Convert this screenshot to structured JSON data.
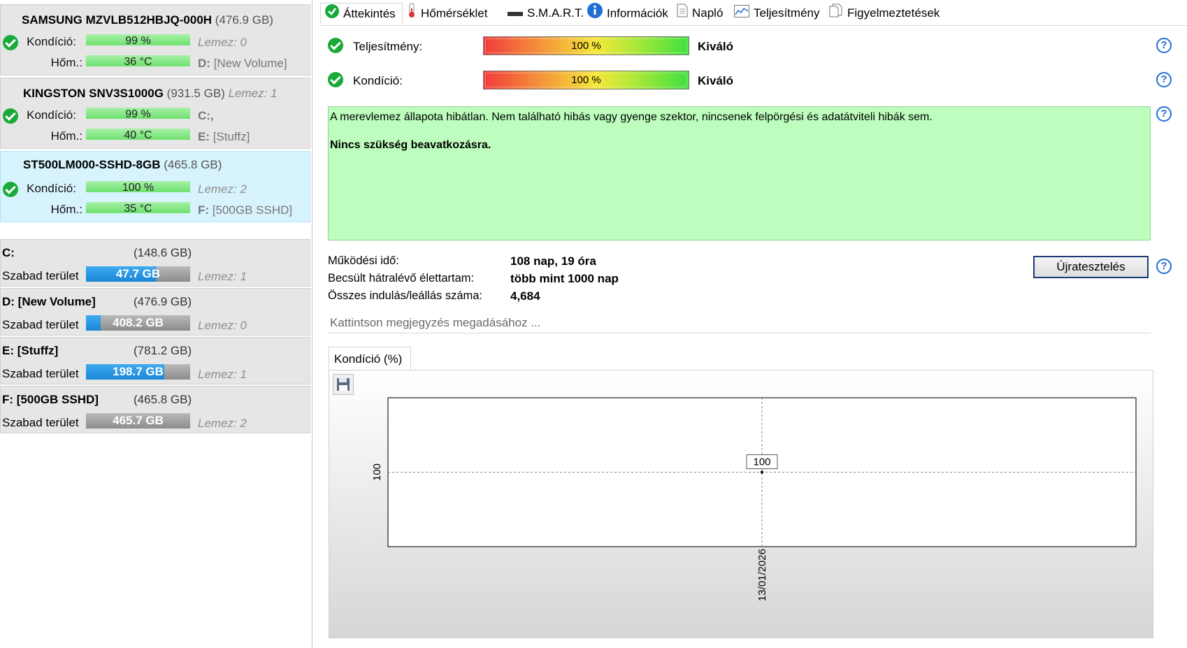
{
  "disks": [
    {
      "model": "SAMSUNG MZVLB512HBJQ-000H",
      "size": "(476.9 GB)",
      "condition_label": "Kondíció:",
      "condition": "99 %",
      "temp_label": "Hőm.:",
      "temp": "36 °C",
      "disk_label": "Lemez: 0",
      "volume_letter": "D:",
      "volume_name": "[New Volume]"
    },
    {
      "model": "KINGSTON SNV3S1000G",
      "size": "(931.5 GB)",
      "disk_label": "Lemez: 1",
      "condition_label": "Kondíció:",
      "condition": "99 %",
      "temp_label": "Hőm.:",
      "temp": "40 °C",
      "volume_letter": "C:,",
      "volume_letter2": "E:",
      "volume_name2": "[Stuffz]"
    },
    {
      "model": "ST500LM000-SSHD-8GB",
      "size": "(465.8 GB)",
      "condition_label": "Kondíció:",
      "condition": "100 %",
      "temp_label": "Hőm.:",
      "temp": "35 °C",
      "disk_label": "Lemez: 2",
      "volume_letter": "F:",
      "volume_name": "[500GB SSHD]"
    }
  ],
  "volumes": [
    {
      "name": "C:",
      "size": "(148.6 GB)",
      "free_label": "Szabad terület",
      "free": "47.7 GB",
      "free_fraction": 0.68,
      "disk": "Lemez: 1"
    },
    {
      "name": "D: [New Volume]",
      "size": "(476.9 GB)",
      "free_label": "Szabad terület",
      "free": "408.2 GB",
      "free_fraction": 0.14,
      "disk": "Lemez: 0"
    },
    {
      "name": "E: [Stuffz]",
      "size": "(781.2 GB)",
      "free_label": "Szabad terület",
      "free": "198.7 GB",
      "free_fraction": 0.75,
      "disk": "Lemez: 1"
    },
    {
      "name": "F: [500GB SSHD]",
      "size": "(465.8 GB)",
      "free_label": "Szabad terület",
      "free": "465.7 GB",
      "free_fraction": 0.0,
      "disk": "Lemez: 2"
    }
  ],
  "tabs": [
    "Áttekintés",
    "Hőmérséklet",
    "S.M.A.R.T.",
    "Információk",
    "Napló",
    "Teljesítmény",
    "Figyelmeztetések"
  ],
  "overview": {
    "performance_label": "Teljesítmény:",
    "performance_value": "100 %",
    "performance_rating": "Kiváló",
    "condition_label": "Kondíció:",
    "condition_value": "100 %",
    "condition_rating": "Kiváló",
    "message_line1": "A merevlemez állapota hibátlan. Nem található hibás vagy gyenge szektor, nincsenek felpörgési és adatátviteli hibák sem.",
    "message_line2": "Nincs szükség beavatkozásra.",
    "uptime_label": "Működési idő:",
    "uptime": "108 nap, 19 óra",
    "lifetime_label": "Becsült hátralévő élettartam:",
    "lifetime": "több mint 1000 nap",
    "startstop_label": "Összes indulás/leállás száma:",
    "startstop": "4,684",
    "retest_button": "Újratesztelés",
    "note_placeholder": "Kattintson megjegyzés megadásához ..."
  },
  "chart_tab": "Kondíció  (%)",
  "chart_data": {
    "type": "line",
    "x": [
      "13/01/2026"
    ],
    "series": [
      {
        "values": [
          100
        ]
      }
    ],
    "ytick": "100",
    "point_label": "100"
  },
  "colors": {
    "ok_green": "#1aaa3a",
    "message_bg": "#bdfdbd",
    "free_bar": "#1a86d6",
    "help_blue": "#1f6fd6"
  }
}
